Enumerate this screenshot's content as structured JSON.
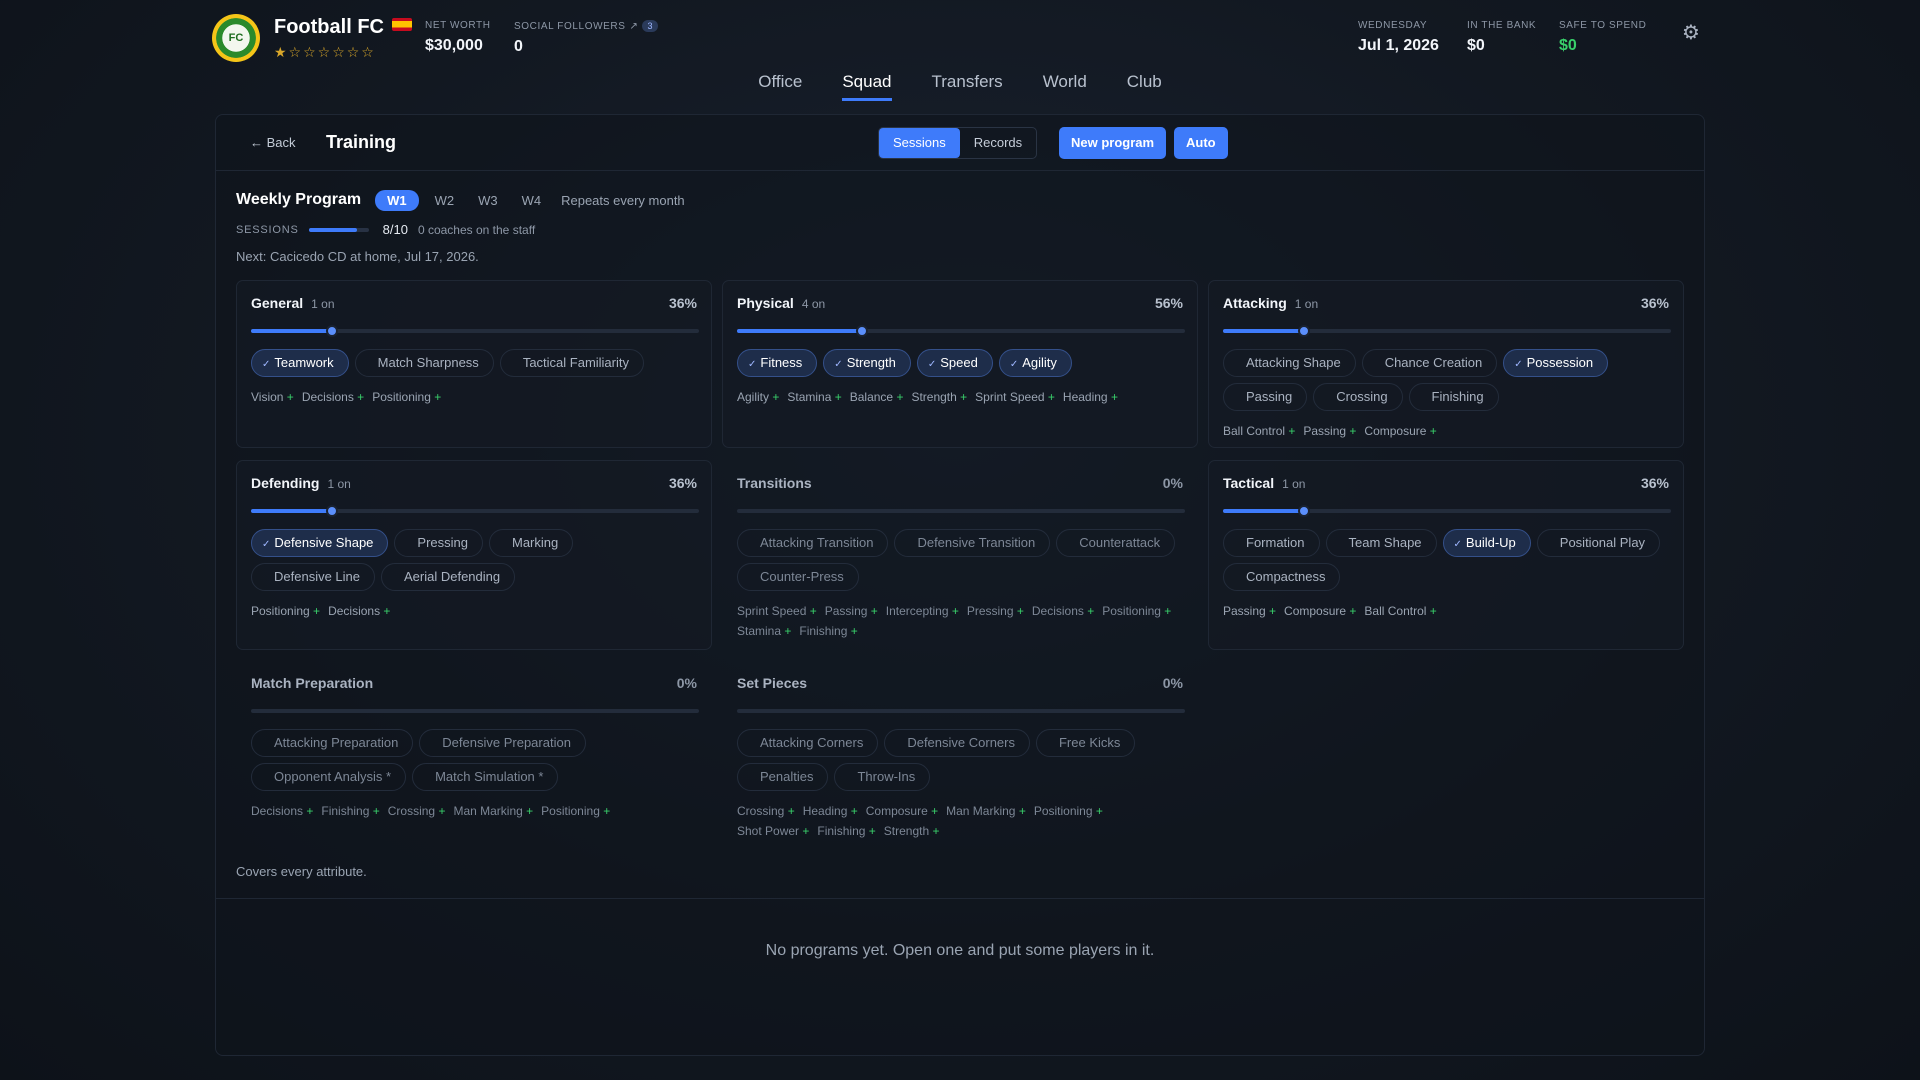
{
  "club": {
    "name": "Football FC",
    "logo_text": "FC",
    "stars": "★☆☆☆☆☆☆"
  },
  "header": {
    "net_worth_label": "NET WORTH",
    "net_worth": "$30,000",
    "followers_label": "SOCIAL FOLLOWERS",
    "followers": "0",
    "followers_badge": "3",
    "day_label": "WEDNESDAY",
    "date": "Jul 1, 2026",
    "bank_label": "IN THE BANK",
    "bank": "$0",
    "safe_label": "SAFE TO SPEND",
    "safe": "$0"
  },
  "nav": {
    "tabs": [
      "Office",
      "Squad",
      "Transfers",
      "World",
      "Club"
    ],
    "active": "Squad"
  },
  "panel": {
    "back": "← Back",
    "title": "Training",
    "seg": [
      "Sessions",
      "Records"
    ],
    "new_program": "New program",
    "auto": "Auto"
  },
  "weekly": {
    "heading": "Weekly Program",
    "weeks": [
      "W1",
      "W2",
      "W3",
      "W4"
    ],
    "repeat": "Repeats every month",
    "sessions_label": "SESSIONS",
    "sessions": "8/10",
    "sessions_fraction": 0.8,
    "coaches": "0 coaches on the staff",
    "next": "Next: Cacicedo CD at home, Jul 17, 2026."
  },
  "cards": [
    {
      "name": "General",
      "count": "1 on",
      "pct": "36%",
      "level": 0.36,
      "chips": [
        {
          "label": "Teamwork",
          "on": true
        },
        {
          "label": "Match Sharpness",
          "on": false
        },
        {
          "label": "Tactical Familiarity",
          "on": false
        }
      ],
      "attrs": [
        "Vision",
        "Decisions",
        "Positioning"
      ]
    },
    {
      "name": "Physical",
      "count": "4 on",
      "pct": "56%",
      "level": 0.56,
      "chips": [
        {
          "label": "Fitness",
          "on": true
        },
        {
          "label": "Strength",
          "on": true
        },
        {
          "label": "Speed",
          "on": true
        },
        {
          "label": "Agility",
          "on": true
        }
      ],
      "attrs": [
        "Agility",
        "Stamina",
        "Balance",
        "Strength",
        "Sprint Speed",
        "Heading"
      ]
    },
    {
      "name": "Attacking",
      "count": "1 on",
      "pct": "36%",
      "level": 0.36,
      "chips": [
        {
          "label": "Attacking Shape",
          "on": false
        },
        {
          "label": "Chance Creation",
          "on": false
        },
        {
          "label": "Possession",
          "on": true
        },
        {
          "label": "Passing",
          "on": false
        },
        {
          "label": "Crossing",
          "on": false
        },
        {
          "label": "Finishing",
          "on": false
        }
      ],
      "attrs": [
        "Ball Control",
        "Passing",
        "Composure"
      ]
    },
    {
      "name": "Defending",
      "count": "1 on",
      "pct": "36%",
      "level": 0.36,
      "chips": [
        {
          "label": "Defensive Shape",
          "on": true
        },
        {
          "label": "Pressing",
          "on": false
        },
        {
          "label": "Marking",
          "on": false
        },
        {
          "label": "Defensive Line",
          "on": false
        },
        {
          "label": "Aerial Defending",
          "on": false
        }
      ],
      "attrs": [
        "Positioning",
        "Decisions"
      ]
    },
    {
      "name": "Transitions",
      "count": "",
      "pct": "0%",
      "level": 0,
      "dim": true,
      "chips": [
        {
          "label": "Attacking Transition",
          "on": false
        },
        {
          "label": "Defensive Transition",
          "on": false
        },
        {
          "label": "Counterattack",
          "on": false
        },
        {
          "label": "Counter-Press",
          "on": false
        }
      ],
      "attrs": [
        "Sprint Speed",
        "Passing",
        "Intercepting",
        "Pressing",
        "Decisions",
        "Positioning",
        "Stamina",
        "Finishing"
      ]
    },
    {
      "name": "Tactical",
      "count": "1 on",
      "pct": "36%",
      "level": 0.36,
      "chips": [
        {
          "label": "Formation",
          "on": false
        },
        {
          "label": "Team Shape",
          "on": false
        },
        {
          "label": "Build-Up",
          "on": true
        },
        {
          "label": "Positional Play",
          "on": false
        },
        {
          "label": "Compactness",
          "on": false
        }
      ],
      "attrs": [
        "Passing",
        "Composure",
        "Ball Control"
      ]
    },
    {
      "name": "Match Preparation",
      "count": "",
      "pct": "0%",
      "level": 0,
      "dim": true,
      "chips": [
        {
          "label": "Attacking Preparation",
          "on": false
        },
        {
          "label": "Defensive Preparation",
          "on": false
        },
        {
          "label": "Opponent Analysis *",
          "on": false
        },
        {
          "label": "Match Simulation *",
          "on": false
        }
      ],
      "attrs": [
        "Decisions",
        "Finishing",
        "Crossing",
        "Man Marking",
        "Positioning"
      ]
    },
    {
      "name": "Set Pieces",
      "count": "",
      "pct": "0%",
      "level": 0,
      "dim": true,
      "chips": [
        {
          "label": "Attacking Corners",
          "on": false
        },
        {
          "label": "Defensive Corners",
          "on": false
        },
        {
          "label": "Free Kicks",
          "on": false
        },
        {
          "label": "Penalties",
          "on": false
        },
        {
          "label": "Throw-Ins",
          "on": false
        }
      ],
      "attrs": [
        "Crossing",
        "Heading",
        "Composure",
        "Man Marking",
        "Positioning",
        "Shot Power",
        "Finishing",
        "Strength"
      ]
    }
  ],
  "footer": {
    "covers": "Covers every attribute.",
    "empty": "No programs yet. Open one and put some players in it."
  }
}
